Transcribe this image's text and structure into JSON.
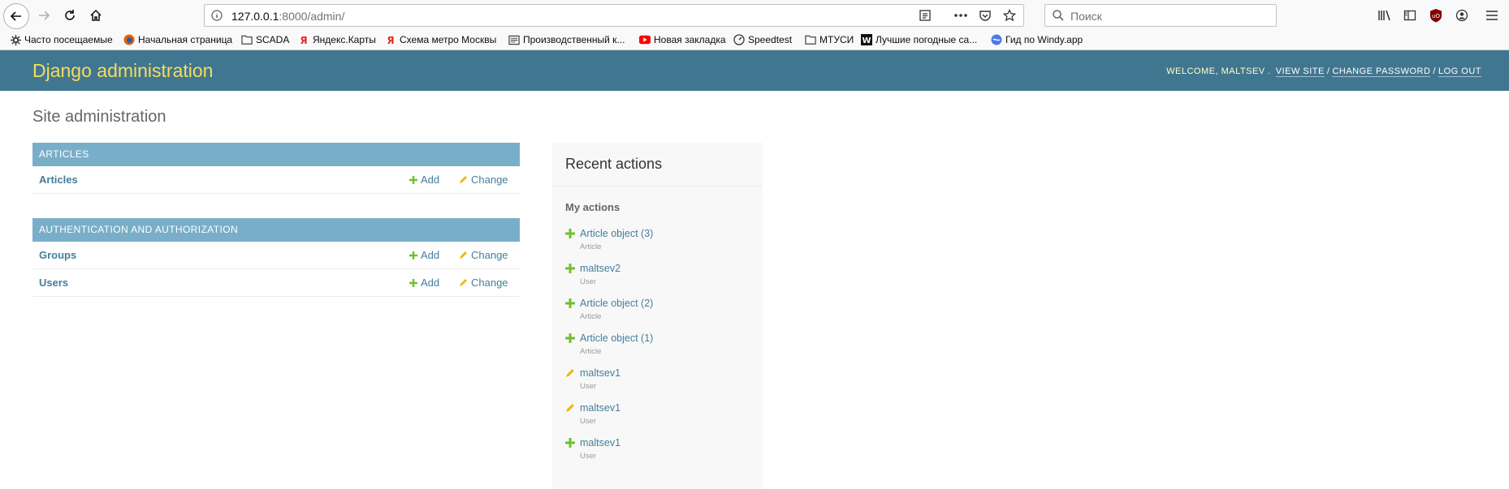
{
  "browser": {
    "url_host": "127.0.0.1",
    "url_rest": ":8000/admin/",
    "search_placeholder": "Поиск",
    "bookmarks": [
      {
        "label": "Часто посещаемые",
        "icon": "gear-icon"
      },
      {
        "label": "Начальная страница",
        "icon": "firefox-icon"
      },
      {
        "label": "SCADA",
        "icon": "folder-icon"
      },
      {
        "label": "Яндекс.Карты",
        "icon": "yandex-icon"
      },
      {
        "label": "Схема метро Москвы",
        "icon": "yandex-icon"
      },
      {
        "label": "Производственный к...",
        "icon": "page-icon"
      },
      {
        "label": "Новая закладка",
        "icon": "youtube-icon"
      },
      {
        "label": "Speedtest",
        "icon": "speedometer-icon"
      },
      {
        "label": "МТУСИ",
        "icon": "folder-icon"
      },
      {
        "label": "Лучшие погодные са...",
        "icon": "w-icon"
      },
      {
        "label": "Гид по Windy.app",
        "icon": "windy-icon"
      }
    ]
  },
  "header": {
    "branding": "Django administration",
    "welcome": "Welcome,",
    "username": "maltsev",
    "view_site": "View site",
    "change_password": "Change password",
    "log_out": "Log out"
  },
  "page_title": "Site administration",
  "modules": [
    {
      "title": "Articles",
      "rows": [
        {
          "name": "Articles",
          "add": "Add",
          "change": "Change"
        }
      ]
    },
    {
      "title": "Authentication and Authorization",
      "rows": [
        {
          "name": "Groups",
          "add": "Add",
          "change": "Change"
        },
        {
          "name": "Users",
          "add": "Add",
          "change": "Change"
        }
      ]
    }
  ],
  "recent": {
    "title": "Recent actions",
    "subtitle": "My actions",
    "items": [
      {
        "label": "Article object (3)",
        "type": "Article",
        "action": "add"
      },
      {
        "label": "maltsev2",
        "type": "User",
        "action": "add"
      },
      {
        "label": "Article object (2)",
        "type": "Article",
        "action": "add"
      },
      {
        "label": "Article object (1)",
        "type": "Article",
        "action": "add"
      },
      {
        "label": "maltsev1",
        "type": "User",
        "action": "change"
      },
      {
        "label": "maltsev1",
        "type": "User",
        "action": "change"
      },
      {
        "label": "maltsev1",
        "type": "User",
        "action": "add"
      }
    ]
  },
  "colors": {
    "header_bg": "#417690",
    "branding": "#f5dd5d",
    "module_head": "#79aec8",
    "link": "#447e9b",
    "add_green": "#70bf2b",
    "change_yellow": "#efb80b"
  }
}
